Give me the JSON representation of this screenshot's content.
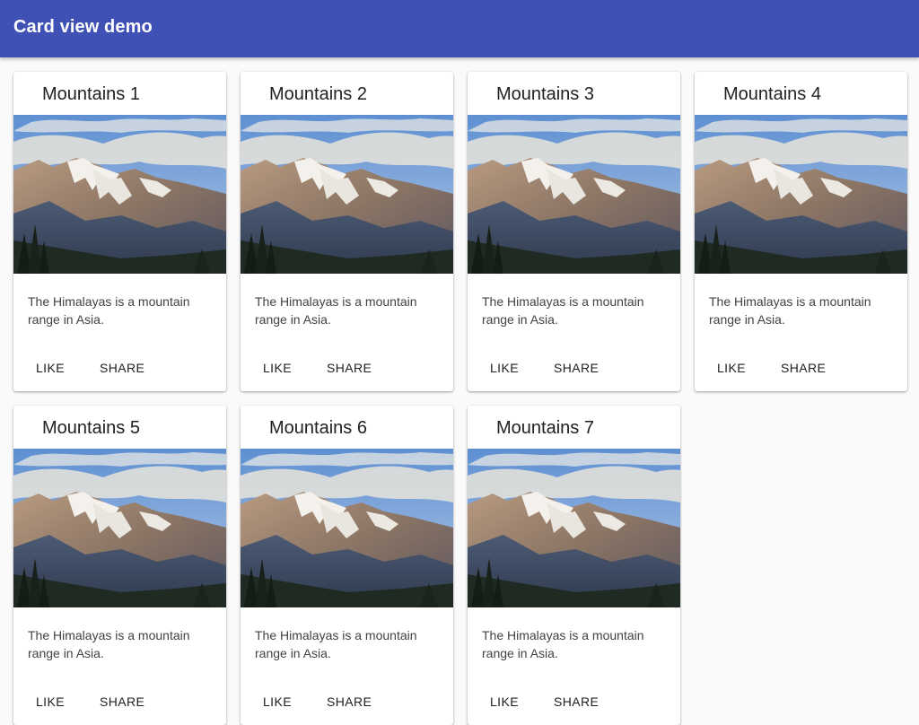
{
  "app_bar": {
    "title": "Card view demo",
    "color": "#3f51b5"
  },
  "cards": [
    {
      "title": "Mountains 1",
      "image": "himalaya-mountain-photo",
      "text": "The Himalayas is a mountain range in Asia.",
      "like_label": "LIKE",
      "share_label": "SHARE"
    },
    {
      "title": "Mountains 2",
      "image": "himalaya-mountain-photo",
      "text": "The Himalayas is a mountain range in Asia.",
      "like_label": "LIKE",
      "share_label": "SHARE"
    },
    {
      "title": "Mountains 3",
      "image": "himalaya-mountain-photo",
      "text": "The Himalayas is a mountain range in Asia.",
      "like_label": "LIKE",
      "share_label": "SHARE"
    },
    {
      "title": "Mountains 4",
      "image": "himalaya-mountain-photo",
      "text": "The Himalayas is a mountain range in Asia.",
      "like_label": "LIKE",
      "share_label": "SHARE"
    },
    {
      "title": "Mountains 5",
      "image": "himalaya-mountain-photo",
      "text": "The Himalayas is a mountain range in Asia.",
      "like_label": "LIKE",
      "share_label": "SHARE"
    },
    {
      "title": "Mountains 6",
      "image": "himalaya-mountain-photo",
      "text": "The Himalayas is a mountain range in Asia.",
      "like_label": "LIKE",
      "share_label": "SHARE"
    },
    {
      "title": "Mountains 7",
      "image": "himalaya-mountain-photo",
      "text": "The Himalayas is a mountain range in Asia.",
      "like_label": "LIKE",
      "share_label": "SHARE"
    }
  ]
}
